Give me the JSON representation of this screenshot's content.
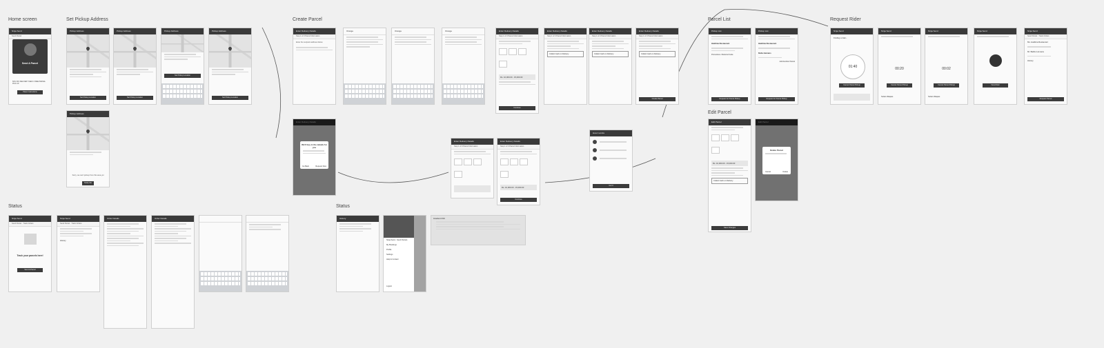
{
  "sections": {
    "home": "Home screen",
    "pickup": "Set Pickup Address",
    "create": "Create Parcel",
    "list": "Parcel List",
    "rider": "Request Rider",
    "edit": "Edit Parcel",
    "status1": "Status",
    "status2": "Status"
  },
  "home": {
    "topbar": "Ninja Send",
    "tab1": "Send Parcel",
    "tab2": "Past Orders",
    "card_title": "Send A Parcel",
    "promo": "60% OFF DELIVERY FEES / FREE PARCEL PICK UP",
    "button": "Place Instructions"
  },
  "pickup": {
    "topbar": "Pickup Address",
    "btn_set": "Set Pickup Location",
    "error_msg": "Sorry, we can't pickup from this area yet",
    "notify": "Notify Me"
  },
  "create": {
    "topbar": "Enter Delivery Details",
    "step": "Step 1 of 3 Parcel Information",
    "search": "Enter the recipient address below",
    "search2": "Orange",
    "continue": "Continue",
    "dialog_title": "We'll buy in the details for you",
    "dialog_cancel": "Go Back",
    "dialog_ok": "Request Now",
    "price": "Rs. 10,000.00 - 15,000.00",
    "collect": "Collect Cash on Delivery",
    "create_btn": "Create Parcel",
    "howto_title": "How it works",
    "got_it": "Got It"
  },
  "list": {
    "topbar": "Pickup List",
    "item1": "Haldinia Restaurant",
    "item2": "Delta Humans",
    "add": "Add Another Parcel",
    "promo": "Promotions / Referral Code",
    "request": "Request for Parcel Pickup",
    "request2": "Request for Parcel Pickup"
  },
  "rider": {
    "topbar": "Ninja Send",
    "finding": "Finding a rider...",
    "t1": "01:40",
    "t2": "00:20",
    "t3": "00:02",
    "cancel": "Cancel Parcel Pickup",
    "view": "View Rider",
    "rider_name": "Sultan Waqass",
    "tab1": "Send Parcel",
    "tab2": "Track Orders",
    "r1": "Ms. Haldinia Restaurant",
    "r2": "Mr. Babbu Humans",
    "history": "History",
    "request_new": "Request Parcel"
  },
  "edit": {
    "topbar": "Edit Parcel",
    "dialog_title": "Delete Parcel",
    "cancel": "Cancel",
    "delete": "Delete",
    "save": "Save Changes",
    "collect": "Collect Cash on Delivery",
    "price": "Rs. 10,000.00 - 15,000.00"
  },
  "status": {
    "topbar": "Ninja Send",
    "tab1": "Send Parcel",
    "tab2": "Track Orders",
    "empty_title": "Track your parcels here!",
    "empty_btn": "Send A Parcel",
    "detail_topbar": "Order Details",
    "history": "History",
    "menu": [
      "Ninja Send - Send Parcels",
      "My Bookings",
      "Profile",
      "Settings",
      "Help & Contact"
    ],
    "logout": "Logout",
    "code_title": "Gradient CSS"
  }
}
